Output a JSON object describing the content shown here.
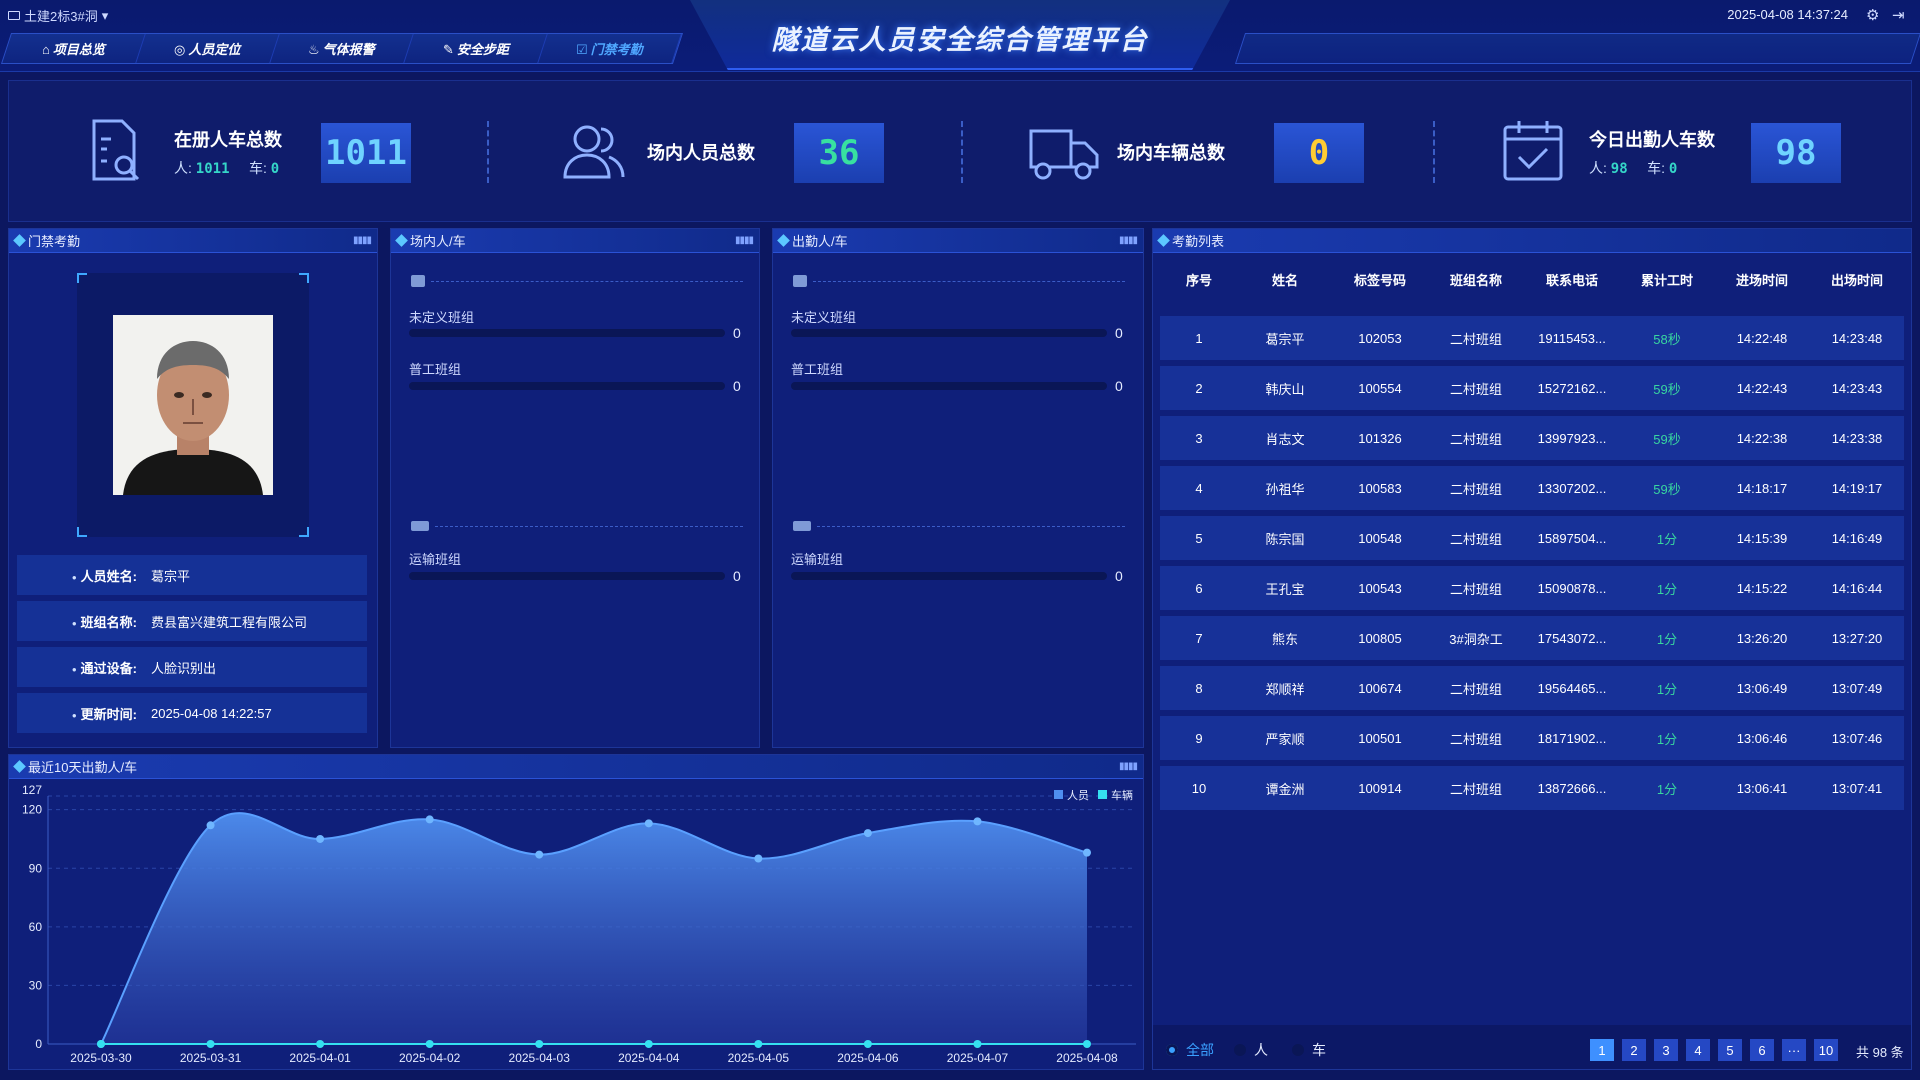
{
  "header": {
    "project": "土建2标3#洞",
    "title": "隧道云人员安全综合管理平台",
    "datetime": "2025-04-08 14:37:24",
    "nav": [
      {
        "label": "项目总览",
        "icon": "home-icon",
        "glyph": "⌂"
      },
      {
        "label": "人员定位",
        "icon": "location-pin-icon",
        "glyph": "◎"
      },
      {
        "label": "气体报警",
        "icon": "flame-icon",
        "glyph": "♨"
      },
      {
        "label": "安全步距",
        "icon": "ruler-pencil-icon",
        "glyph": "✎"
      },
      {
        "label": "门禁考勤",
        "icon": "calendar-check-icon",
        "glyph": "☑"
      }
    ],
    "active_nav": 4
  },
  "stats": [
    {
      "label": "在册人车总数",
      "value": "1011",
      "person_label": "人:",
      "person_value": "1011",
      "vehicle_label": "车:",
      "vehicle_value": "0",
      "icon": "document-search-icon",
      "value_color": "#6fd3ff"
    },
    {
      "label": "场内人员总数",
      "value": "36",
      "icon": "users-icon",
      "value_color": "#38e0a0"
    },
    {
      "label": "场内车辆总数",
      "value": "0",
      "icon": "truck-icon",
      "value_color": "#ffcc33"
    },
    {
      "label": "今日出勤人车数",
      "value": "98",
      "person_label": "人:",
      "person_value": "98",
      "vehicle_label": "车:",
      "vehicle_value": "0",
      "icon": "calendar-check-icon",
      "value_color": "#6fd3ff"
    }
  ],
  "access": {
    "title": "门禁考勤",
    "rows": [
      {
        "key": "人员姓名:",
        "value": "葛宗平"
      },
      {
        "key": "班组名称:",
        "value": "费县富兴建筑工程有限公司"
      },
      {
        "key": "通过设备:",
        "value": "人脸识别出"
      },
      {
        "key": "更新时间:",
        "value": "2025-04-08 14:22:57"
      }
    ]
  },
  "inside": {
    "title": "场内人/车",
    "person_groups": [
      {
        "name": "未定义班组",
        "value": "0"
      },
      {
        "name": "普工班组",
        "value": "0"
      }
    ],
    "vehicle_groups": [
      {
        "name": "运输班组",
        "value": "0"
      }
    ]
  },
  "outside": {
    "title": "出勤人/车",
    "person_groups": [
      {
        "name": "未定义班组",
        "value": "0"
      },
      {
        "name": "普工班组",
        "value": "0"
      }
    ],
    "vehicle_groups": [
      {
        "name": "运输班组",
        "value": "0"
      }
    ]
  },
  "attendance": {
    "title": "考勤列表",
    "columns": [
      "序号",
      "姓名",
      "标签号码",
      "班组名称",
      "联系电话",
      "累计工时",
      "进场时间",
      "出场时间"
    ],
    "rows": [
      [
        "1",
        "葛宗平",
        "102053",
        "二村班组",
        "19115453...",
        "58秒",
        "14:22:48",
        "14:23:48"
      ],
      [
        "2",
        "韩庆山",
        "100554",
        "二村班组",
        "15272162...",
        "59秒",
        "14:22:43",
        "14:23:43"
      ],
      [
        "3",
        "肖志文",
        "101326",
        "二村班组",
        "13997923...",
        "59秒",
        "14:22:38",
        "14:23:38"
      ],
      [
        "4",
        "孙祖华",
        "100583",
        "二村班组",
        "13307202...",
        "59秒",
        "14:18:17",
        "14:19:17"
      ],
      [
        "5",
        "陈宗国",
        "100548",
        "二村班组",
        "15897504...",
        "1分",
        "14:15:39",
        "14:16:49"
      ],
      [
        "6",
        "王孔宝",
        "100543",
        "二村班组",
        "15090878...",
        "1分",
        "14:15:22",
        "14:16:44"
      ],
      [
        "7",
        "熊东",
        "100805",
        "3#洞杂工",
        "17543072...",
        "1分",
        "13:26:20",
        "13:27:20"
      ],
      [
        "8",
        "郑顺祥",
        "100674",
        "二村班组",
        "19564465...",
        "1分",
        "13:06:49",
        "13:07:49"
      ],
      [
        "9",
        "严家顺",
        "100501",
        "二村班组",
        "18171902...",
        "1分",
        "13:06:46",
        "13:07:46"
      ],
      [
        "10",
        "谭金洲",
        "100914",
        "二村班组",
        "13872666...",
        "1分",
        "13:06:41",
        "13:07:41"
      ]
    ],
    "filters": [
      "全部",
      "人",
      "车"
    ],
    "active_filter": 0,
    "pages": [
      "1",
      "2",
      "3",
      "4",
      "5",
      "6",
      "···",
      "10"
    ],
    "active_page": 0,
    "total": "共 98 条"
  },
  "trend": {
    "title": "最近10天出勤人/车"
  },
  "chart_data": {
    "type": "area",
    "x": [
      "2025-03-30",
      "2025-03-31",
      "2025-04-01",
      "2025-04-02",
      "2025-04-03",
      "2025-04-04",
      "2025-04-05",
      "2025-04-06",
      "2025-04-07",
      "2025-04-08"
    ],
    "series": [
      {
        "name": "人员",
        "values": [
          0,
          112,
          105,
          115,
          97,
          113,
          95,
          108,
          114,
          98
        ],
        "color": "#4f8ff0"
      },
      {
        "name": "车辆",
        "values": [
          0,
          0,
          0,
          0,
          0,
          0,
          0,
          0,
          0,
          0
        ],
        "color": "#35e0f0"
      }
    ],
    "yticks": [
      "0",
      "30",
      "60",
      "90",
      "120",
      "127"
    ],
    "ylim": [
      0,
      127
    ],
    "legend": "top-right",
    "grid": true
  }
}
